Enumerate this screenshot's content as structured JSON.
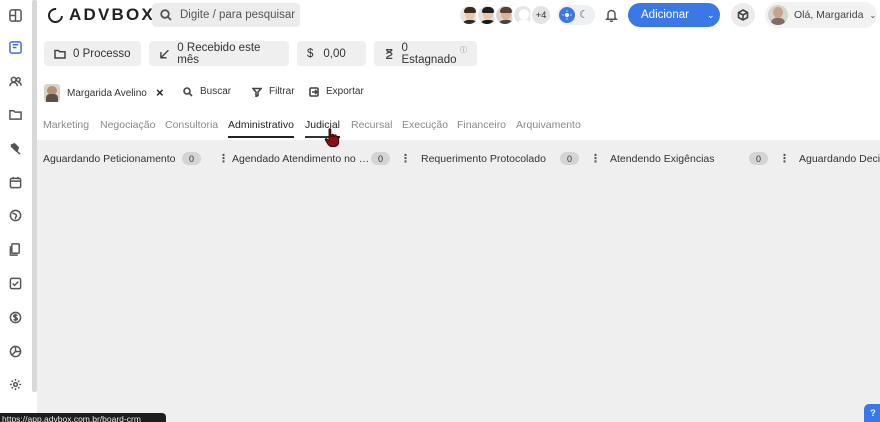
{
  "brand": {
    "name": "ADVBOX"
  },
  "search": {
    "placeholder": "Digite / para pesquisar"
  },
  "team": {
    "more_count": "+4"
  },
  "header": {
    "add_label": "Adicionar",
    "user_greeting": "Olá, Margarida"
  },
  "stats": {
    "processes": "0 Processo",
    "received": "0 Recebido este mês",
    "amount": "0,00",
    "currency": "$",
    "stagnant": "0 Estagnado"
  },
  "filter": {
    "user_name": "Margarida Avelino",
    "search_label": "Buscar",
    "filter_label": "Filtrar",
    "export_label": "Exportar"
  },
  "tabs": [
    {
      "label": "Marketing"
    },
    {
      "label": "Negociação"
    },
    {
      "label": "Consultoria"
    },
    {
      "label": "Administrativo"
    },
    {
      "label": "Judicial"
    },
    {
      "label": "Recursal"
    },
    {
      "label": "Execução"
    },
    {
      "label": "Financeiro"
    },
    {
      "label": "Arquivamento"
    }
  ],
  "columns": [
    {
      "title": "Aguardando Peticionamento",
      "count": "0"
    },
    {
      "title": "Agendado Atendimento no Ór...",
      "count": "0"
    },
    {
      "title": "Requerimento Protocolado",
      "count": "0"
    },
    {
      "title": "Atendendo Exigências",
      "count": "0"
    },
    {
      "title": "Aguardando Decis",
      "count": ""
    }
  ],
  "status_bar": {
    "url": "https://app.advbox.com.br/board-crm"
  },
  "colors": {
    "accent": "#3b78e7",
    "board_bg": "#efefef",
    "chip_bg": "#efefef"
  },
  "icons": {
    "sidebar": [
      "dashboard-icon",
      "board-icon",
      "contacts-icon",
      "folder-icon",
      "gavel-icon",
      "calendar-icon",
      "globe-icon",
      "documents-icon",
      "tasks-icon",
      "finance-icon",
      "pie-chart-icon",
      "settings-icon"
    ]
  }
}
